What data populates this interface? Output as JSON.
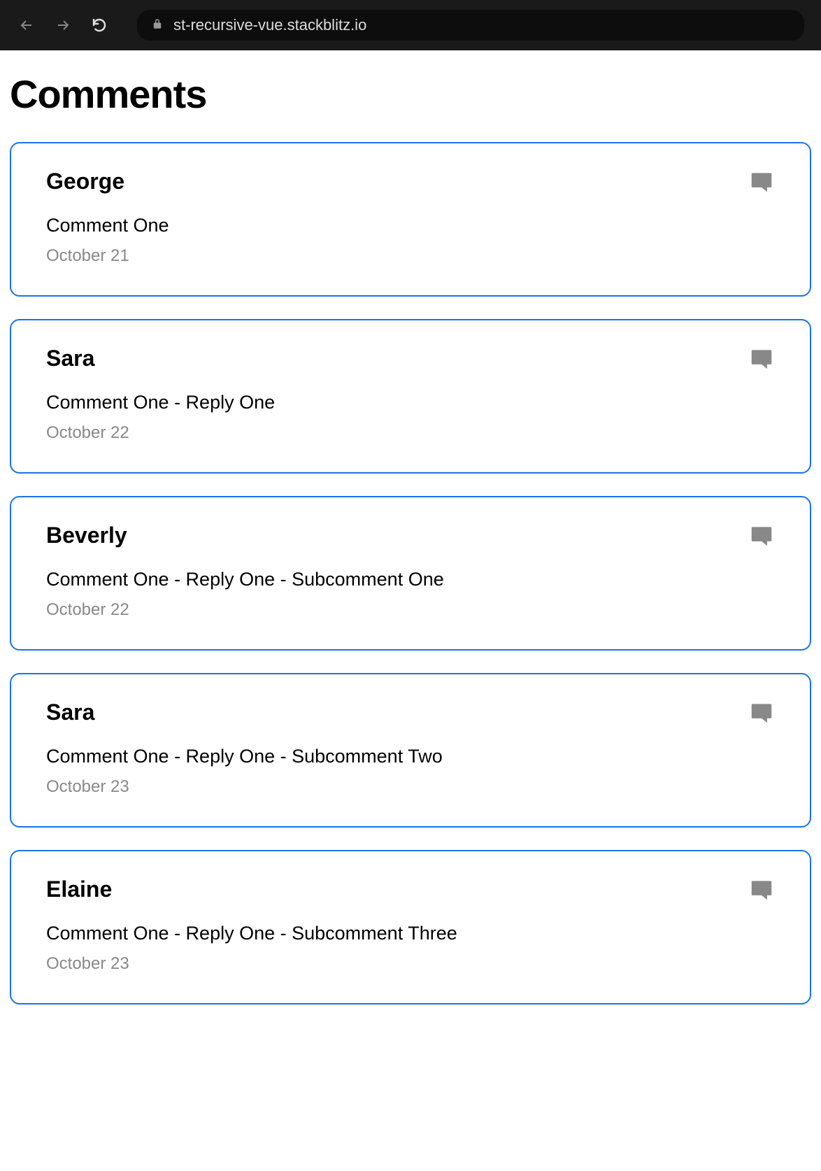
{
  "browser": {
    "url": "st-recursive-vue.stackblitz.io"
  },
  "page": {
    "title": "Comments"
  },
  "comments": [
    {
      "author": "George",
      "body": "Comment One",
      "date": "October 21"
    },
    {
      "author": "Sara",
      "body": "Comment One - Reply One",
      "date": "October 22"
    },
    {
      "author": "Beverly",
      "body": "Comment One - Reply One - Subcomment One",
      "date": "October 22"
    },
    {
      "author": "Sara",
      "body": "Comment One - Reply One - Subcomment Two",
      "date": "October 23"
    },
    {
      "author": "Elaine",
      "body": "Comment One - Reply One - Subcomment Three",
      "date": "October 23"
    }
  ]
}
